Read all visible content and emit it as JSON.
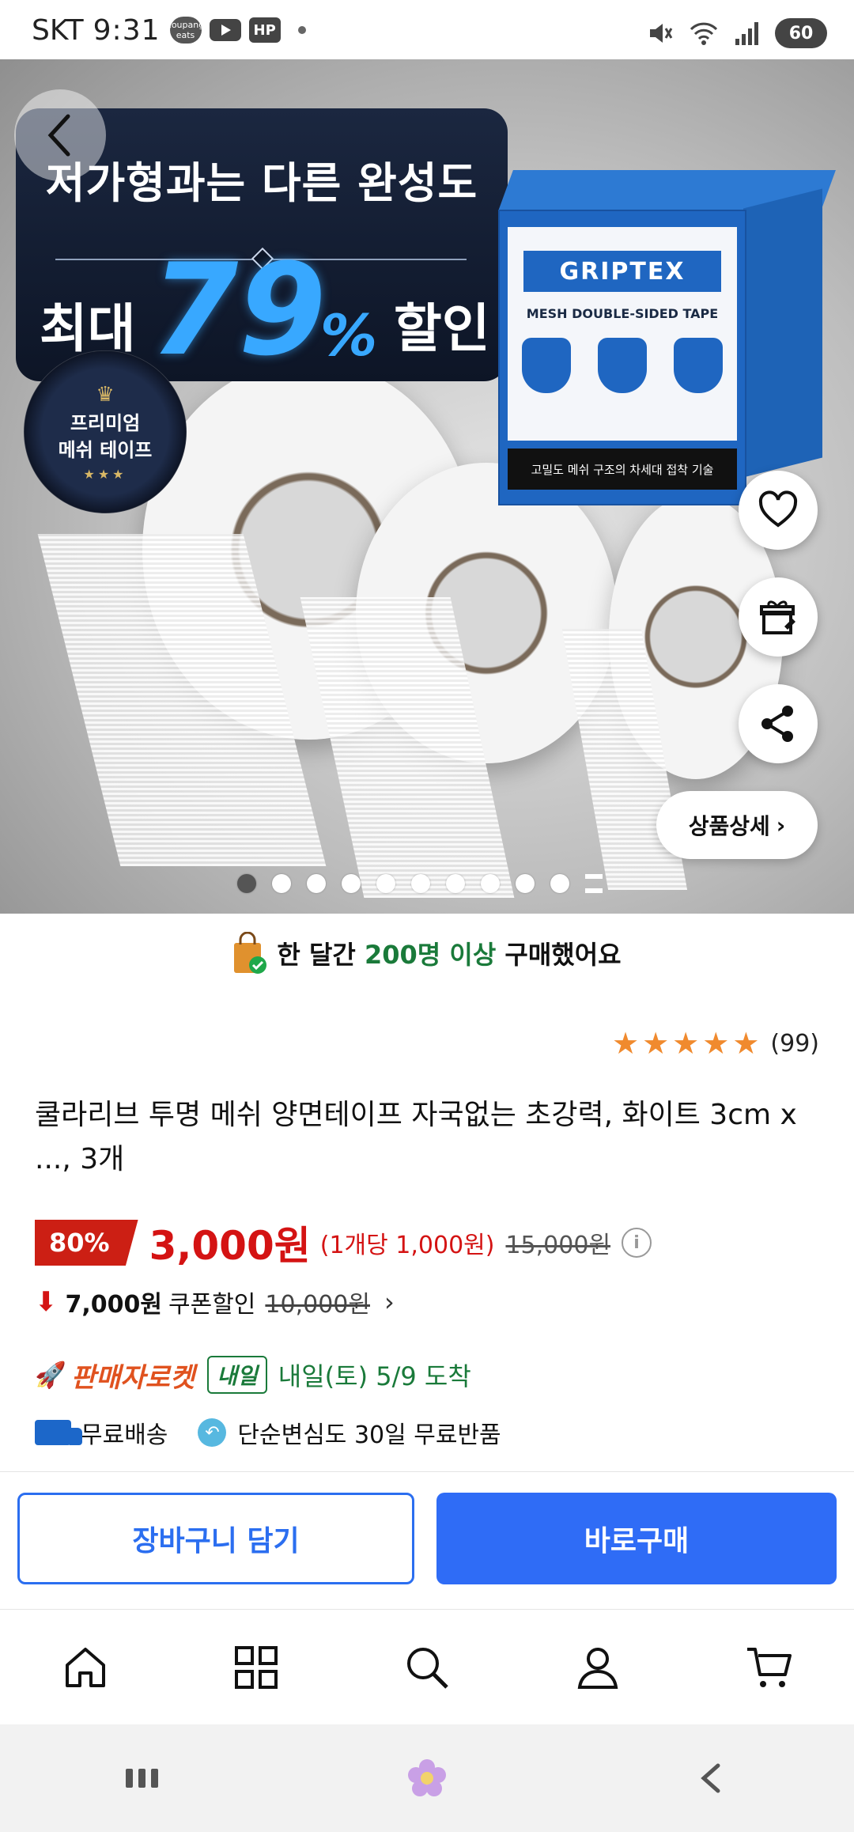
{
  "status_bar": {
    "carrier": "SKT",
    "time": "9:31",
    "app_badge": "coupang eats",
    "hp_badge": "HP",
    "battery": "60"
  },
  "hero": {
    "banner_line1": "저가형과는 다른 완성도",
    "banner_max": "최대",
    "banner_number": "79",
    "banner_percent": "%",
    "banner_sale": "할인",
    "seal_line1": "프리미엄",
    "seal_line2": "메쉬 테이프",
    "box_brand": "GRIPTEX",
    "box_title": "MESH DOUBLE-SIDED TAPE",
    "box_strip": "고밀도 메쉬 구조의 차세대 접착 기술",
    "detail_label": "상품상세",
    "page_count": 11,
    "active_page": 1
  },
  "purchase": {
    "prefix": "한 달간",
    "count": "200명 이상",
    "suffix": "구매했어요"
  },
  "rating": {
    "stars": 5,
    "count": "(99)"
  },
  "product": {
    "title": "쿨라리브 투명 메쉬 양면테이프 자국없는 초강력, 화이트 3cm x ..., 3개"
  },
  "price": {
    "discount": "80%",
    "current": "3,000원",
    "unit": "(1개당 1,000원)",
    "original": "15,000원",
    "info": "i"
  },
  "coupon": {
    "amount": "7,000원",
    "label": "쿠폰할인",
    "original": "10,000원"
  },
  "delivery": {
    "seller_rocket": "판매자로켓",
    "tomorrow_badge": "내일",
    "arrival": "내일(토) 5/9 도착",
    "free_shipping": "무료배송",
    "free_return": "단순변심도 30일 무료반품"
  },
  "actions": {
    "cart": "장바구니 담기",
    "buy": "바로구매"
  },
  "colors": {
    "primary": "#2f6cf6",
    "discount_red": "#d41313",
    "delivery_green": "#1a7a3a",
    "rocket_orange": "#e0521f",
    "star": "#f08a2e"
  }
}
